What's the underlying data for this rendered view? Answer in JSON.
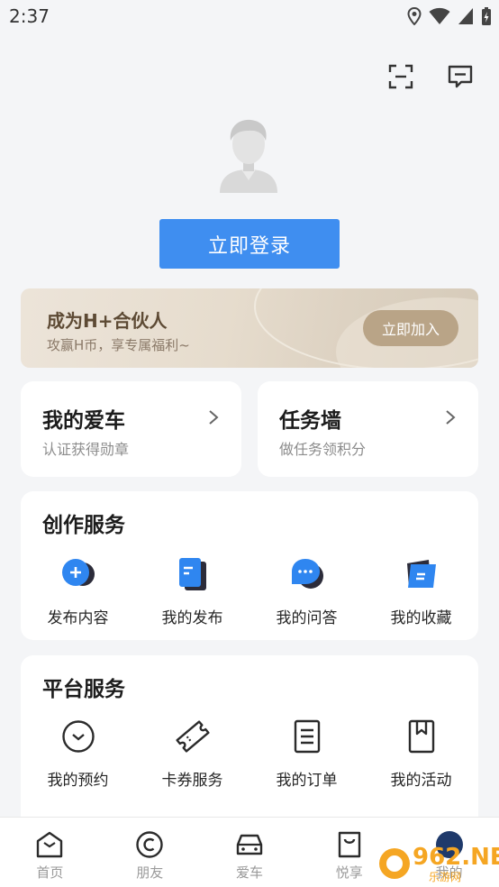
{
  "status_bar": {
    "time": "2:37",
    "icons": [
      "location-icon",
      "wifi-icon",
      "signal-icon",
      "battery-charging-icon"
    ]
  },
  "top_actions": [
    "scan-icon",
    "message-icon"
  ],
  "login": {
    "label": "立即登录"
  },
  "partner_banner": {
    "title": "成为H+合伙人",
    "subtitle": "攻赢H币，享专属福利~",
    "button": "立即加入"
  },
  "my_car": {
    "title": "我的爱车",
    "subtitle": "认证获得勋章"
  },
  "task_wall": {
    "title": "任务墙",
    "subtitle": "做任务领积分"
  },
  "creation_services": {
    "title": "创作服务",
    "items": [
      {
        "label": "发布内容",
        "icon": "publish-plus-icon"
      },
      {
        "label": "我的发布",
        "icon": "my-posts-icon"
      },
      {
        "label": "我的问答",
        "icon": "qa-chat-icon"
      },
      {
        "label": "我的收藏",
        "icon": "favorites-icon"
      }
    ]
  },
  "platform_services": {
    "title": "平台服务",
    "items": [
      {
        "label": "我的预约",
        "icon": "appointment-icon"
      },
      {
        "label": "卡券服务",
        "icon": "coupon-icon"
      },
      {
        "label": "我的订单",
        "icon": "order-icon"
      },
      {
        "label": "我的活动",
        "icon": "activity-bookmark-icon"
      }
    ]
  },
  "bottom_nav": {
    "items": [
      {
        "label": "首页",
        "icon": "home-icon"
      },
      {
        "label": "朋友",
        "icon": "friends-icon"
      },
      {
        "label": "爱车",
        "icon": "car-icon"
      },
      {
        "label": "悦享",
        "icon": "shopping-bag-icon"
      },
      {
        "label": "我的",
        "icon": "profile-icon"
      }
    ]
  },
  "watermark": {
    "text": "962.NET",
    "sub": "乐游网"
  },
  "colors": {
    "primary": "#3f8ef0",
    "gold": "#b9a487",
    "gold_text": "#5d4a34"
  }
}
